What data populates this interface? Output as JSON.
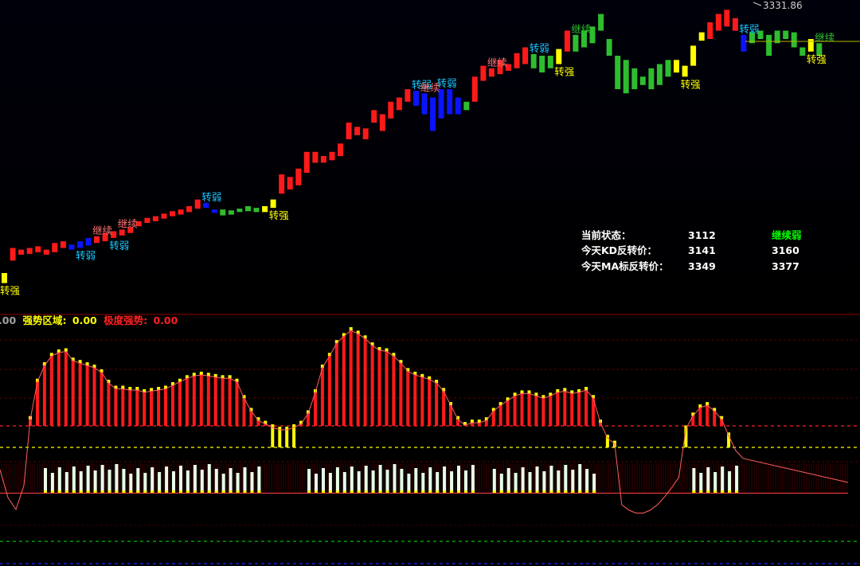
{
  "chart_data": [
    {
      "type": "candlestick",
      "high_label": "3331.86",
      "colors": {
        "up": "#ff1a1a",
        "weak": "#0a14ff",
        "down": "#2ebd2e",
        "turn_up": "#ffff00"
      },
      "bars": [
        {
          "o": 3118,
          "c": 3130,
          "col": "turn_up"
        },
        {
          "o": 3145,
          "c": 3160,
          "col": "up"
        },
        {
          "o": 3152,
          "c": 3158,
          "col": "up"
        },
        {
          "o": 3153,
          "c": 3160,
          "col": "up"
        },
        {
          "o": 3155,
          "c": 3162,
          "col": "up"
        },
        {
          "o": 3152,
          "c": 3158,
          "col": "up"
        },
        {
          "o": 3155,
          "c": 3166,
          "col": "up"
        },
        {
          "o": 3160,
          "c": 3168,
          "col": "up"
        },
        {
          "o": 3158,
          "c": 3164,
          "col": "weak"
        },
        {
          "o": 3160,
          "c": 3168,
          "col": "weak"
        },
        {
          "o": 3163,
          "c": 3172,
          "col": "weak"
        },
        {
          "o": 3166,
          "c": 3174,
          "col": "up"
        },
        {
          "o": 3168,
          "c": 3178,
          "col": "up"
        },
        {
          "o": 3172,
          "c": 3180,
          "col": "up"
        },
        {
          "o": 3175,
          "c": 3182,
          "col": "up"
        },
        {
          "o": 3178,
          "c": 3185,
          "col": "up"
        },
        {
          "o": 3186,
          "c": 3192,
          "col": "up"
        },
        {
          "o": 3190,
          "c": 3196,
          "col": "up"
        },
        {
          "o": 3192,
          "c": 3198,
          "col": "up"
        },
        {
          "o": 3195,
          "c": 3201,
          "col": "up"
        },
        {
          "o": 3198,
          "c": 3204,
          "col": "up"
        },
        {
          "o": 3200,
          "c": 3206,
          "col": "up"
        },
        {
          "o": 3203,
          "c": 3210,
          "col": "up"
        },
        {
          "o": 3207,
          "c": 3218,
          "col": "up"
        },
        {
          "o": 3208,
          "c": 3214,
          "col": "weak"
        },
        {
          "o": 3202,
          "c": 3206,
          "col": "weak"
        },
        {
          "o": 3199,
          "c": 3206,
          "col": "down"
        },
        {
          "o": 3200,
          "c": 3205,
          "col": "down"
        },
        {
          "o": 3203,
          "c": 3207,
          "col": "down"
        },
        {
          "o": 3204,
          "c": 3210,
          "col": "down"
        },
        {
          "o": 3203,
          "c": 3208,
          "col": "down"
        },
        {
          "o": 3203,
          "c": 3210,
          "col": "turn_up"
        },
        {
          "o": 3208,
          "c": 3218,
          "col": "turn_up"
        },
        {
          "o": 3225,
          "c": 3248,
          "col": "up"
        },
        {
          "o": 3230,
          "c": 3245,
          "col": "up"
        },
        {
          "o": 3235,
          "c": 3255,
          "col": "up"
        },
        {
          "o": 3250,
          "c": 3275,
          "col": "up"
        },
        {
          "o": 3262,
          "c": 3275,
          "col": "up"
        },
        {
          "o": 3262,
          "c": 3270,
          "col": "up"
        },
        {
          "o": 3265,
          "c": 3275,
          "col": "up"
        },
        {
          "o": 3270,
          "c": 3285,
          "col": "up"
        },
        {
          "o": 3290,
          "c": 3310,
          "col": "up"
        },
        {
          "o": 3295,
          "c": 3305,
          "col": "up"
        },
        {
          "o": 3290,
          "c": 3303,
          "col": "up"
        },
        {
          "o": 3310,
          "c": 3325,
          "col": "up"
        },
        {
          "o": 3300,
          "c": 3320,
          "col": "up"
        },
        {
          "o": 3315,
          "c": 3335,
          "col": "up"
        },
        {
          "o": 3325,
          "c": 3340,
          "col": "up"
        },
        {
          "o": 3335,
          "c": 3350,
          "col": "up"
        },
        {
          "o": 3330,
          "c": 3348,
          "col": "weak"
        },
        {
          "o": 3320,
          "c": 3345,
          "col": "weak"
        },
        {
          "o": 3300,
          "c": 3340,
          "col": "weak"
        },
        {
          "o": 3315,
          "c": 3350,
          "col": "weak"
        },
        {
          "o": 3320,
          "c": 3350,
          "col": "weak"
        },
        {
          "o": 3320,
          "c": 3340,
          "col": "weak"
        },
        {
          "o": 3325,
          "c": 3335,
          "col": "down"
        },
        {
          "o": 3335,
          "c": 3365,
          "col": "up"
        },
        {
          "o": 3360,
          "c": 3378,
          "col": "up"
        },
        {
          "o": 3365,
          "c": 3375,
          "col": "up"
        },
        {
          "o": 3368,
          "c": 3385,
          "col": "up"
        },
        {
          "o": 3372,
          "c": 3380,
          "col": "up"
        },
        {
          "o": 3375,
          "c": 3393,
          "col": "up"
        },
        {
          "o": 3380,
          "c": 3400,
          "col": "up"
        },
        {
          "o": 3375,
          "c": 3392,
          "col": "down"
        },
        {
          "o": 3370,
          "c": 3390,
          "col": "down"
        },
        {
          "o": 3375,
          "c": 3390,
          "col": "down"
        },
        {
          "o": 3380,
          "c": 3398,
          "col": "turn_up"
        },
        {
          "o": 3395,
          "c": 3420,
          "col": "up"
        },
        {
          "o": 3395,
          "c": 3415,
          "col": "down"
        },
        {
          "o": 3400,
          "c": 3420,
          "col": "down"
        },
        {
          "o": 3405,
          "c": 3425,
          "col": "down"
        },
        {
          "o": 3420,
          "c": 3440,
          "col": "down"
        },
        {
          "o": 3390,
          "c": 3410,
          "col": "down"
        },
        {
          "o": 3350,
          "c": 3390,
          "col": "down"
        },
        {
          "o": 3345,
          "c": 3385,
          "col": "down"
        },
        {
          "o": 3350,
          "c": 3375,
          "col": "down"
        },
        {
          "o": 3355,
          "c": 3365,
          "col": "down"
        },
        {
          "o": 3350,
          "c": 3375,
          "col": "down"
        },
        {
          "o": 3355,
          "c": 3380,
          "col": "down"
        },
        {
          "o": 3365,
          "c": 3385,
          "col": "down"
        },
        {
          "o": 3370,
          "c": 3385,
          "col": "turn_up"
        },
        {
          "o": 3365,
          "c": 3378,
          "col": "turn_up"
        },
        {
          "o": 3378,
          "c": 3402,
          "col": "turn_up"
        },
        {
          "o": 3408,
          "c": 3418,
          "col": "turn_up"
        },
        {
          "o": 3410,
          "c": 3430,
          "col": "up"
        },
        {
          "o": 3420,
          "c": 3440,
          "col": "up"
        },
        {
          "o": 3425,
          "c": 3445,
          "col": "up"
        },
        {
          "o": 3420,
          "c": 3435,
          "col": "up"
        },
        {
          "o": 3395,
          "c": 3415,
          "col": "weak"
        },
        {
          "o": 3405,
          "c": 3418,
          "col": "down"
        },
        {
          "o": 3410,
          "c": 3420,
          "col": "down"
        },
        {
          "o": 3390,
          "c": 3415,
          "col": "down"
        },
        {
          "o": 3405,
          "c": 3420,
          "col": "down"
        },
        {
          "o": 3410,
          "c": 3420,
          "col": "down"
        },
        {
          "o": 3400,
          "c": 3418,
          "col": "down"
        },
        {
          "o": 3390,
          "c": 3400,
          "col": "down"
        },
        {
          "o": 3395,
          "c": 3410,
          "col": "turn_up"
        },
        {
          "o": 3390,
          "c": 3405,
          "col": "down"
        }
      ],
      "annotations": [
        {
          "text": "转强",
          "bar": 0,
          "pos": "below",
          "color": "#ffff00"
        },
        {
          "text": "转弱",
          "bar": 9,
          "pos": "below",
          "color": "#19c8ff"
        },
        {
          "text": "继续",
          "bar": 11,
          "pos": "above",
          "color": "#ff7070"
        },
        {
          "text": "转弱",
          "bar": 13,
          "pos": "below",
          "color": "#19c8ff"
        },
        {
          "text": "继续",
          "bar": 14,
          "pos": "above",
          "color": "#ff7070"
        },
        {
          "text": "转弱",
          "bar": 24,
          "pos": "above",
          "color": "#19c8ff"
        },
        {
          "text": "转强",
          "bar": 32,
          "pos": "below",
          "color": "#ffff00"
        },
        {
          "text": "转弱",
          "bar": 49,
          "pos": "above",
          "color": "#19c8ff"
        },
        {
          "text": "继续",
          "bar": 50,
          "pos": "above",
          "color": "#ff7070"
        },
        {
          "text": "转弱",
          "bar": 52,
          "pos": "above",
          "color": "#19c8ff"
        },
        {
          "text": "继续",
          "bar": 58,
          "pos": "above",
          "color": "#ff7070"
        },
        {
          "text": "转弱",
          "bar": 63,
          "pos": "above",
          "color": "#19c8ff"
        },
        {
          "text": "转强",
          "bar": 66,
          "pos": "below",
          "color": "#ffff00"
        },
        {
          "text": "继续",
          "bar": 68,
          "pos": "above",
          "color": "#2ebd2e"
        },
        {
          "text": "转强",
          "bar": 81,
          "pos": "below",
          "color": "#ffff00"
        },
        {
          "text": "转弱",
          "bar": 88,
          "pos": "above",
          "color": "#19c8ff"
        },
        {
          "text": "转强",
          "bar": 96,
          "pos": "below",
          "color": "#ffff00"
        },
        {
          "text": "继续",
          "bar": 97,
          "pos": "above",
          "color": "#2ebd2e"
        }
      ]
    },
    {
      "type": "bar",
      "heights": [
        0.24,
        0.56,
        0.7,
        0.78,
        0.81,
        0.82,
        0.74,
        0.72,
        0.7,
        0.68,
        0.64,
        0.55,
        0.5,
        0.5,
        0.49,
        0.49,
        0.47,
        0.48,
        0.49,
        0.5,
        0.53,
        0.56,
        0.59,
        0.61,
        0.62,
        0.61,
        0.6,
        0.59,
        0.59,
        0.56,
        0.42,
        0.31,
        0.23,
        0.2,
        0.17,
        0.15,
        0.15,
        0.17,
        0.2,
        0.29,
        0.47,
        0.68,
        0.78,
        0.89,
        0.95,
        1.0,
        0.97,
        0.93,
        0.87,
        0.83,
        0.82,
        0.78,
        0.72,
        0.65,
        0.62,
        0.6,
        0.58,
        0.55,
        0.48,
        0.36,
        0.24,
        0.19,
        0.21,
        0.21,
        0.23,
        0.31,
        0.36,
        0.4,
        0.44,
        0.46,
        0.46,
        0.44,
        0.42,
        0.44,
        0.47,
        0.48,
        0.46,
        0.47,
        0.49,
        0.42,
        0.21,
        0.08,
        0.03,
        0.01,
        0.0,
        0.0,
        0.0,
        0.0,
        0.0,
        0.0,
        0.0,
        0.0,
        0.16,
        0.27,
        0.34,
        0.36,
        0.31,
        0.24,
        0.1,
        0.0,
        0.0
      ],
      "white_bars": [
        0,
        1,
        1,
        1,
        1,
        1,
        1,
        1,
        1,
        1,
        1,
        1,
        1,
        1,
        1,
        1,
        1,
        1,
        1,
        1,
        1,
        1,
        1,
        1,
        1,
        1,
        1,
        1,
        1,
        1,
        1,
        1,
        0,
        0,
        0,
        0,
        0,
        0,
        1,
        1,
        1,
        1,
        1,
        1,
        1,
        1,
        1,
        1,
        1,
        1,
        1,
        1,
        1,
        1,
        1,
        1,
        1,
        1,
        1,
        1,
        1,
        1,
        0,
        0,
        1,
        1,
        1,
        1,
        1,
        1,
        1,
        1,
        1,
        1,
        1,
        1,
        1,
        1,
        1,
        0,
        0,
        0,
        0,
        0,
        0,
        0,
        0,
        0,
        0,
        0,
        0,
        0,
        1,
        1,
        1,
        1,
        1,
        1,
        1,
        0,
        0
      ]
    }
  ],
  "info": {
    "rows": [
      {
        "label": "当前状态：",
        "v1": "3112",
        "v2": "继续弱",
        "v2_color": "#00ff00"
      },
      {
        "label": "今天KD反转价：",
        "v1": "3141",
        "v2": "3160",
        "v2_color": "#ffffff"
      },
      {
        "label": "今天MA标反转价：",
        "v1": "3349",
        "v2": "3377",
        "v2_color": "#ffffff"
      }
    ]
  },
  "indicator_header": {
    "prefix": ".00",
    "label1": "强势区域:",
    "val1": "0.00",
    "label2": "极度强势:",
    "val2": "0.00"
  }
}
